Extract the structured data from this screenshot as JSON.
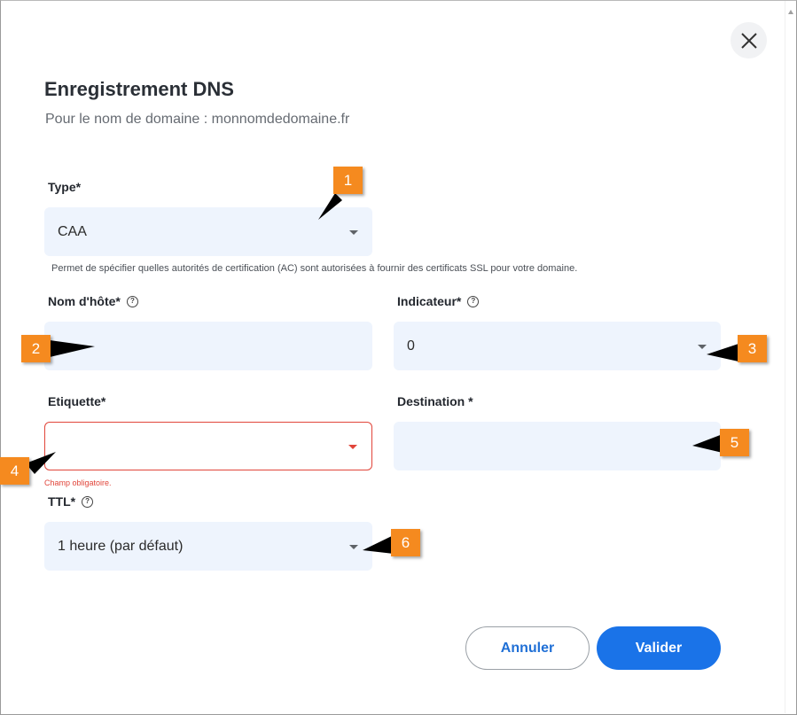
{
  "dialog": {
    "title": "Enregistrement DNS",
    "subtitle": "Pour le nom de domaine : monnomdedomaine.fr"
  },
  "form": {
    "type": {
      "label": "Type*",
      "value": "CAA",
      "helper": "Permet de spécifier quelles autorités de certification (AC) sont autorisées à fournir des certificats SSL pour votre domaine."
    },
    "hostname": {
      "label": "Nom d'hôte*",
      "value": ""
    },
    "flag": {
      "label": "Indicateur*",
      "value": "0"
    },
    "tag": {
      "label": "Etiquette*",
      "value": "",
      "error": "Champ obligatoire."
    },
    "destination": {
      "label": "Destination *",
      "value": ""
    },
    "ttl": {
      "label": "TTL*",
      "value": "1 heure (par défaut)"
    }
  },
  "actions": {
    "cancel": "Annuler",
    "submit": "Valider"
  },
  "annotations": [
    "1",
    "2",
    "3",
    "4",
    "5",
    "6"
  ],
  "icons": {
    "close": "close-icon",
    "help": "help-circle-icon",
    "dropdown": "caret-down-icon"
  },
  "colors": {
    "accent": "#1a73e8",
    "field_bg": "#eef4fd",
    "error": "#e1453a",
    "badge": "#f58a1f"
  }
}
